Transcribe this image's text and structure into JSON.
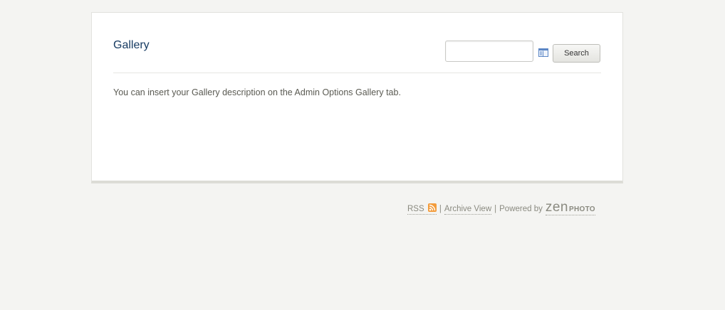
{
  "gallery": {
    "title": "Gallery",
    "description": "You can insert your Gallery description on the Admin Options Gallery tab."
  },
  "search": {
    "value": "",
    "placeholder": "",
    "button_label": "Search",
    "fields_icon": "search-fields-icon"
  },
  "footer": {
    "rss_label": "RSS",
    "rss_icon": "rss-icon",
    "separator": "|",
    "archive_label": "Archive View",
    "powered_by": "Powered by",
    "logo_zen": "zen",
    "logo_photo": "PHOTO"
  },
  "colors": {
    "background": "#f4f4f2",
    "title": "#163a61",
    "text": "#5a5a52",
    "footer_text": "#8a8a80",
    "rss_orange": "#f39c3c"
  }
}
